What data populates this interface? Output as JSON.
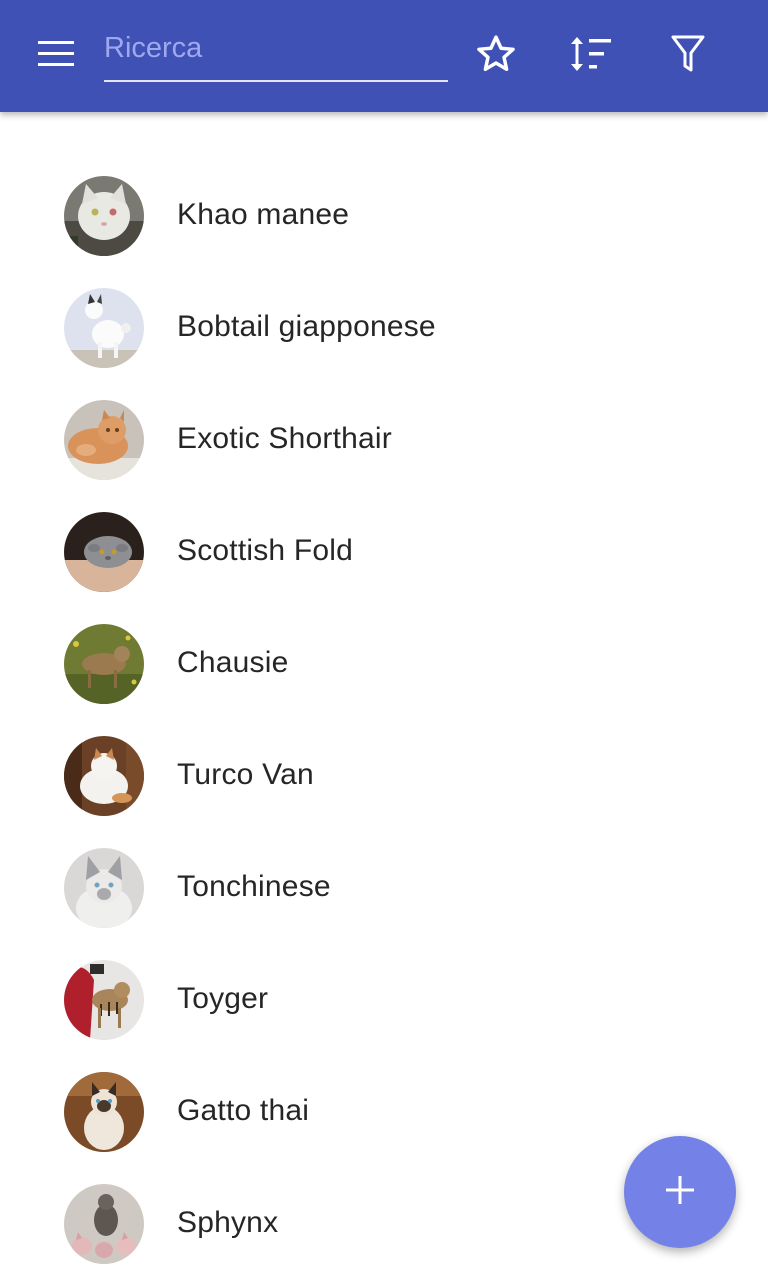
{
  "appbar": {
    "background": "#3f51b5",
    "menu_icon": "menu-icon",
    "search": {
      "placeholder": "Ricerca",
      "value": ""
    },
    "actions": [
      {
        "name": "favorites",
        "icon": "star-outline-icon"
      },
      {
        "name": "sort",
        "icon": "sort-icon"
      },
      {
        "name": "filter",
        "icon": "filter-icon"
      }
    ]
  },
  "breeds": [
    {
      "name": "Khao manee",
      "avatar": "cat-photo"
    },
    {
      "name": "Bobtail giapponese",
      "avatar": "cat-photo"
    },
    {
      "name": "Exotic Shorthair",
      "avatar": "cat-photo"
    },
    {
      "name": "Scottish Fold",
      "avatar": "cat-photo"
    },
    {
      "name": "Chausie",
      "avatar": "cat-photo"
    },
    {
      "name": "Turco Van",
      "avatar": "cat-photo"
    },
    {
      "name": "Tonchinese",
      "avatar": "cat-photo"
    },
    {
      "name": "Toyger",
      "avatar": "cat-photo"
    },
    {
      "name": "Gatto thai",
      "avatar": "cat-photo"
    },
    {
      "name": "Sphynx",
      "avatar": "cat-photo"
    }
  ],
  "fab": {
    "icon": "plus-icon",
    "color": "#7481e6"
  }
}
